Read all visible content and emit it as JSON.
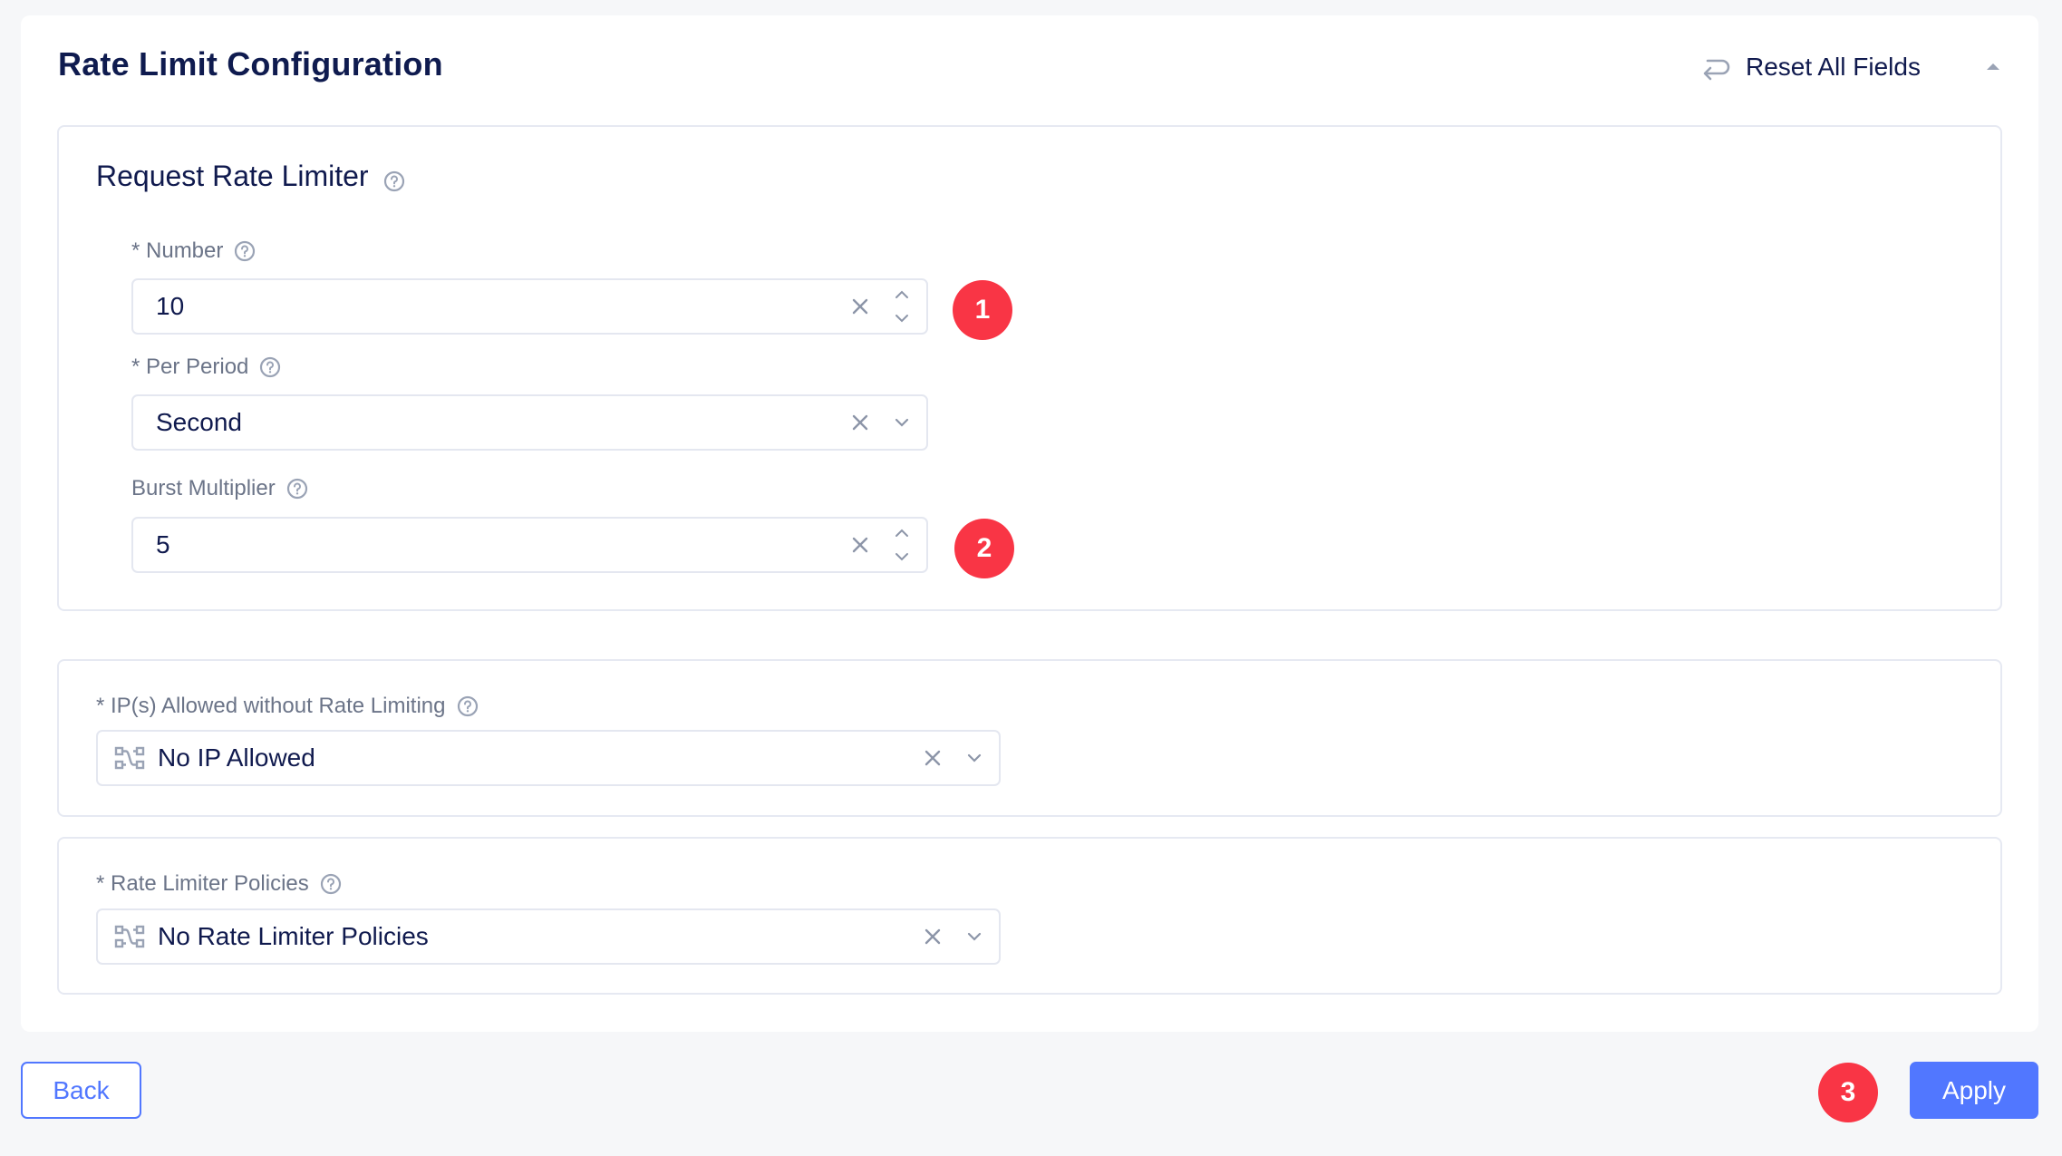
{
  "page": {
    "title": "Rate Limit Configuration",
    "reset_label": "Reset All Fields",
    "collapse_icon": "chevron-up-icon",
    "reset_icon": "undo-return-icon"
  },
  "request_rate_limiter": {
    "title": "Request Rate Limiter",
    "help_icon": "help-circle-icon",
    "fields": {
      "number": {
        "label": "* Number",
        "value": "10",
        "type": "number-stepper"
      },
      "per_period": {
        "label": "* Per Period",
        "value": "Second",
        "type": "select"
      },
      "burst_multiplier": {
        "label": "Burst Multiplier",
        "value": "5",
        "type": "number-stepper"
      }
    }
  },
  "ip_allowed": {
    "label": "* IP(s) Allowed without Rate Limiting",
    "value": "No IP Allowed",
    "icon": "network-icon"
  },
  "rate_limiter_policies": {
    "label": "* Rate Limiter Policies",
    "value": "No Rate Limiter Policies",
    "icon": "network-icon"
  },
  "annotations": [
    "1",
    "2",
    "3"
  ],
  "footer": {
    "back_label": "Back",
    "apply_label": "Apply"
  },
  "colors": {
    "primary": "#5177FF",
    "badge": "#F93545",
    "title_text": "#0F1B4F",
    "label_text": "#6B7488",
    "icon_gray": "#9AA3B5",
    "border": "#E6E9F2",
    "page_bg": "#F6F7F9"
  }
}
